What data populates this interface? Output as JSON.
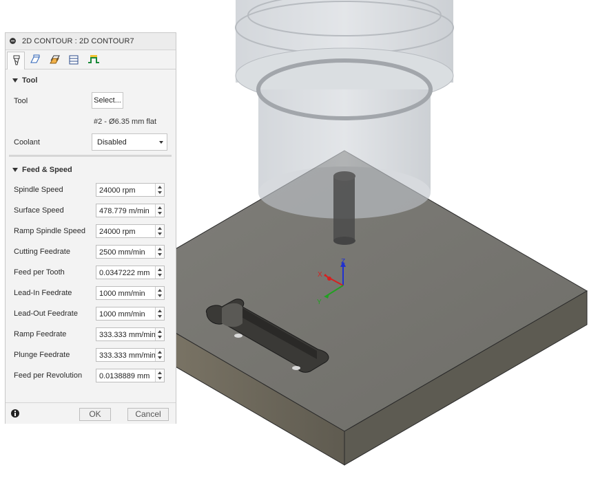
{
  "dialog": {
    "title": "2D CONTOUR : 2D CONTOUR7",
    "tabs": [
      {
        "icon": "tool-icon",
        "active": true
      },
      {
        "icon": "geometry-icon",
        "active": false
      },
      {
        "icon": "heights-icon",
        "active": false
      },
      {
        "icon": "passes-icon",
        "active": false
      },
      {
        "icon": "linking-icon",
        "active": false
      }
    ],
    "tool_section": {
      "header": "Tool",
      "tool_label": "Tool",
      "select_button": "Select...",
      "tool_description": "#2 - Ø6.35 mm flat",
      "coolant_label": "Coolant",
      "coolant_value": "Disabled"
    },
    "feed_section": {
      "header": "Feed & Speed",
      "rows": [
        {
          "label": "Spindle Speed",
          "value": "24000 rpm"
        },
        {
          "label": "Surface Speed",
          "value": "478.779 m/min"
        },
        {
          "label": "Ramp Spindle Speed",
          "value": "24000 rpm"
        },
        {
          "label": "Cutting Feedrate",
          "value": "2500 mm/min"
        },
        {
          "label": "Feed per Tooth",
          "value": "0.0347222 mm"
        },
        {
          "label": "Lead-In Feedrate",
          "value": "1000 mm/min"
        },
        {
          "label": "Lead-Out Feedrate",
          "value": "1000 mm/min"
        },
        {
          "label": "Ramp Feedrate",
          "value": "333.333 mm/min"
        },
        {
          "label": "Plunge Feedrate",
          "value": "333.333 mm/min"
        },
        {
          "label": "Feed per Revolution",
          "value": "0.0138889 mm"
        }
      ]
    },
    "footer": {
      "ok_label": "OK",
      "cancel_label": "Cancel"
    }
  },
  "viewport": {
    "axis_x": "X",
    "axis_y": "Y",
    "axis_z": "Z",
    "colors": {
      "stock_top": "#7a7a75",
      "stock_front": "#6a6558",
      "stock_side": "#5c5a52",
      "x_axis": "#d62020",
      "y_axis": "#22a022",
      "z_axis": "#2030d0"
    }
  }
}
